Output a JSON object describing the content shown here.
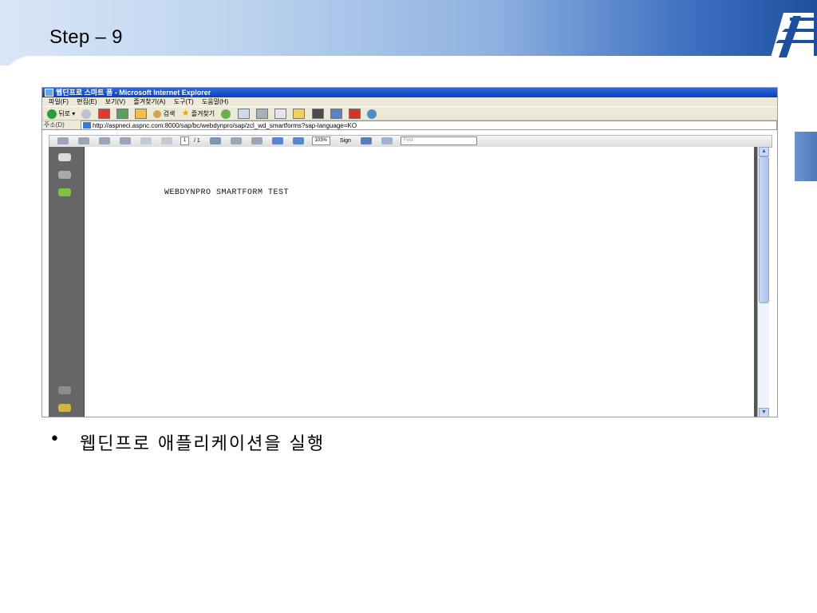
{
  "slide": {
    "title": "Step – 9",
    "bullet_symbol": "•",
    "bullet_text": "웹딘프로 애플리케이션을 실행"
  },
  "browser": {
    "window_title": "웹딘프로 스마트 폼 - Microsoft Internet Explorer",
    "menu": [
      "파일(F)",
      "편집(E)",
      "보기(V)",
      "즐겨찾기(A)",
      "도구(T)",
      "도움말(H)"
    ],
    "toolbar": {
      "back_label": "뒤로",
      "search_label": "검색",
      "favorites_label": "즐겨찾기"
    },
    "address_label": "주소(D)",
    "address_url": "http://aspneci.aspnc.com:8000/sap/bc/webdynpro/sap/zcl_wd_smartforms?sap-language=KO"
  },
  "pdf_viewer": {
    "page_current": "1",
    "page_total": "/ 1",
    "zoom": "103%",
    "sign_label": "Sign",
    "find_placeholder": "Find",
    "document_text": "WEBDYNPRO SMARTFORM TEST"
  },
  "colors": {
    "title_bar": "#0a3fb8",
    "nav_pane": "#666666",
    "header_accent": "#1d4f9e"
  }
}
